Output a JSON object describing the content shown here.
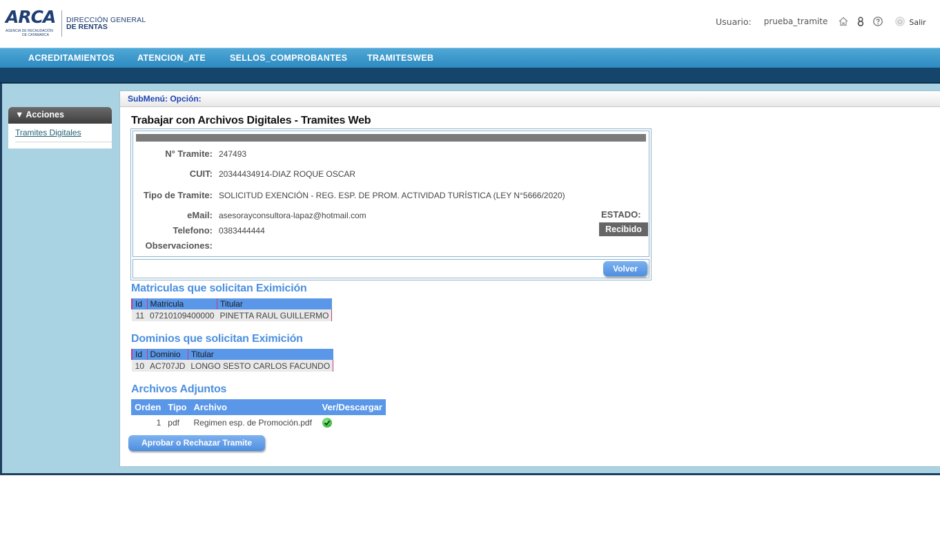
{
  "header": {
    "logo_text": "ARCA",
    "logo_sub1": "AGENCIA DE RECAUDACIÓN",
    "logo_sub2": "DE CATAMARCA",
    "org_line1": "DIRECCIÓN GENERAL",
    "org_line2": "DE RENTAS",
    "user_label": "Usuario:",
    "user_name": "prueba_tramite",
    "icons": [
      "home-icon",
      "lock-icon",
      "help-icon",
      "power-icon"
    ],
    "logout_label": "Salir"
  },
  "nav": {
    "items": [
      "ACREDITAMIENTOS",
      "ATENCION_ATE",
      "SELLOS_COMPROBANTES",
      "TRAMITESWEB"
    ]
  },
  "sidebar": {
    "title": "▼ Acciones",
    "link": "Tramites Digitales"
  },
  "submenu": {
    "label": "SubMenú: Opción:"
  },
  "page": {
    "title": "Trabajar con Archivos Digitales - Tramites Web"
  },
  "detail": {
    "labels": {
      "tramite": "N° Tramite:",
      "cuit": "CUIT:",
      "tipo": "Tipo de Tramite:",
      "email": "eMail:",
      "telefono": "Telefono:",
      "observaciones": "Observaciones:"
    },
    "values": {
      "tramite": "247493",
      "cuit": "20344434914",
      "cuit_sep": "-",
      "nombre": "DIAZ ROQUE OSCAR",
      "tipo": "SOLICITUD EXENCIÓN - REG. ESP. DE PROM. ACTIVIDAD TURÍSTICA (LEY N°5666/2020)",
      "email": "asesorayconsultora-lapaz@hotmail.com",
      "telefono": "0383444444",
      "observaciones": ""
    },
    "estado_label": "ESTADO:",
    "estado_value": "Recibido",
    "volver_label": "Volver"
  },
  "matriculas": {
    "title": "Matriculas que solicitan Eximición",
    "headers": [
      "Id",
      "Matricula",
      "Titular"
    ],
    "rows": [
      [
        "11",
        "07210109400000",
        "PINETTA RAUL GUILLERMO"
      ]
    ]
  },
  "dominios": {
    "title": "Dominios que solicitan Eximición",
    "headers": [
      "Id",
      "Dominio",
      "Titular"
    ],
    "rows": [
      [
        "10",
        "AC707JD",
        "LONGO SESTO CARLOS FACUNDO"
      ]
    ]
  },
  "adjuntos": {
    "title": "Archivos Adjuntos",
    "headers": [
      "Orden",
      "Tipo",
      "Archivo",
      "Ver/Descargar"
    ],
    "rows": [
      [
        "1",
        "pdf",
        "Regimen esp. de Promoción.pdf"
      ]
    ],
    "download_icon": "check-download-icon"
  },
  "actions": {
    "aprobar_label": "Aprobar o Rechazar Tramite"
  },
  "colors": {
    "nav_blue": "#2d89c0",
    "dark_bar": "#16456b",
    "frame_bg": "#a9d3e3",
    "accent_blue": "#4b8fdf",
    "table_header": "#5a97e8",
    "status_gray": "#666666"
  }
}
